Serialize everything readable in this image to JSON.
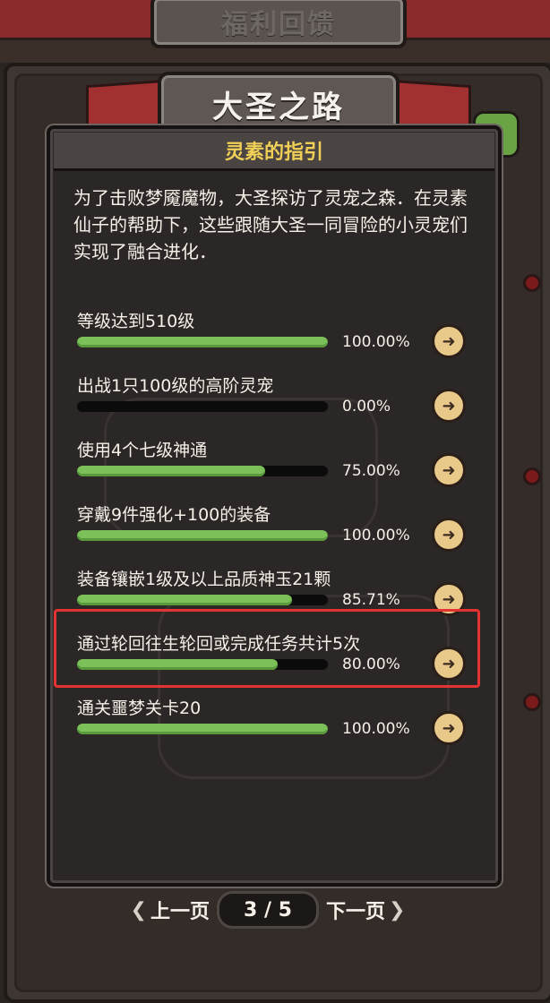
{
  "top_banner": {
    "title": "福利回馈"
  },
  "event": {
    "title": "大圣之路"
  },
  "dialog": {
    "header": "灵素的指引",
    "intro": "为了击败梦魇魔物，大圣探访了灵宠之森．在灵素仙子的帮助下，这些跟随大圣一同冒险的小灵宠们实现了融合进化．"
  },
  "tasks": [
    {
      "label": "等级达到510级",
      "progress": 1.0,
      "percent_text": "100.00%"
    },
    {
      "label": "出战1只100级的高阶灵宠",
      "progress": 0.0,
      "percent_text": "0.00%"
    },
    {
      "label": "使用4个七级神通",
      "progress": 0.75,
      "percent_text": "75.00%"
    },
    {
      "label": "穿戴9件强化+100的装备",
      "progress": 1.0,
      "percent_text": "100.00%"
    },
    {
      "label": "装备镶嵌1级及以上品质神玉21颗",
      "progress": 0.8571,
      "percent_text": "85.71%"
    },
    {
      "label": "通过轮回往生轮回或完成任务共计5次",
      "progress": 0.8,
      "percent_text": "80.00%",
      "highlighted": true
    },
    {
      "label": "通关噩梦关卡20",
      "progress": 1.0,
      "percent_text": "100.00%"
    }
  ],
  "pager": {
    "prev": "上一页",
    "next": "下一页",
    "page_text": "3 / 5"
  },
  "colors": {
    "accent_gold": "#f0cf57",
    "progress_green": "#7cc05a",
    "highlight_red": "#e53232"
  }
}
